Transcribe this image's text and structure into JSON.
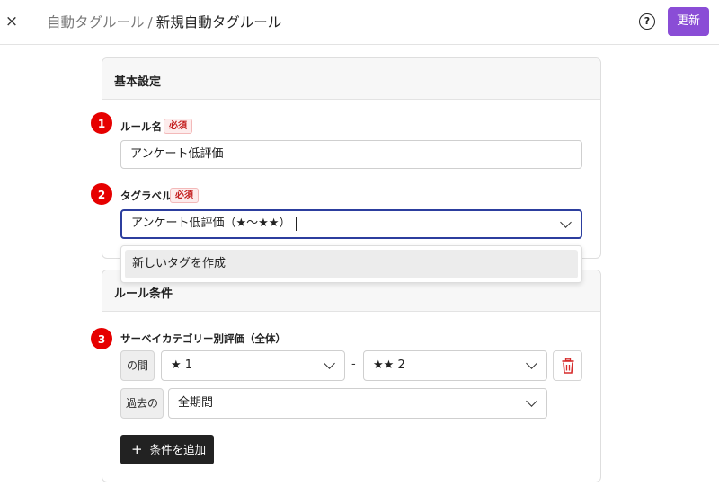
{
  "header": {
    "close_label": "×",
    "breadcrumb_parent": "自動タグルール",
    "breadcrumb_sep": "/",
    "breadcrumb_current": "新規自動タグルール",
    "help_label": "?",
    "update_label": "更新",
    "accent_color": "#8a4dd6"
  },
  "basic_settings": {
    "title": "基本設定",
    "rule_name": {
      "step": "1",
      "label": "ルール名",
      "required": "必須",
      "value": "アンケート低評価"
    },
    "tag_label": {
      "step": "2",
      "label": "タグラベル",
      "required": "必須",
      "value": "アンケート低評価（★〜★★）",
      "dropdown_option": "新しいタグを作成"
    }
  },
  "rule_conditions": {
    "title": "ルール条件",
    "survey_rating": {
      "step": "3",
      "label": "サーベイカテゴリー別評価（全体）",
      "range_tag": "の間",
      "from_value": "★ 1",
      "range_sep": "-",
      "to_value": "★★ 2",
      "period_tag": "過去の",
      "period_value": "全期間"
    },
    "add_condition_plus": "+",
    "add_condition_label": "条件を追加"
  }
}
